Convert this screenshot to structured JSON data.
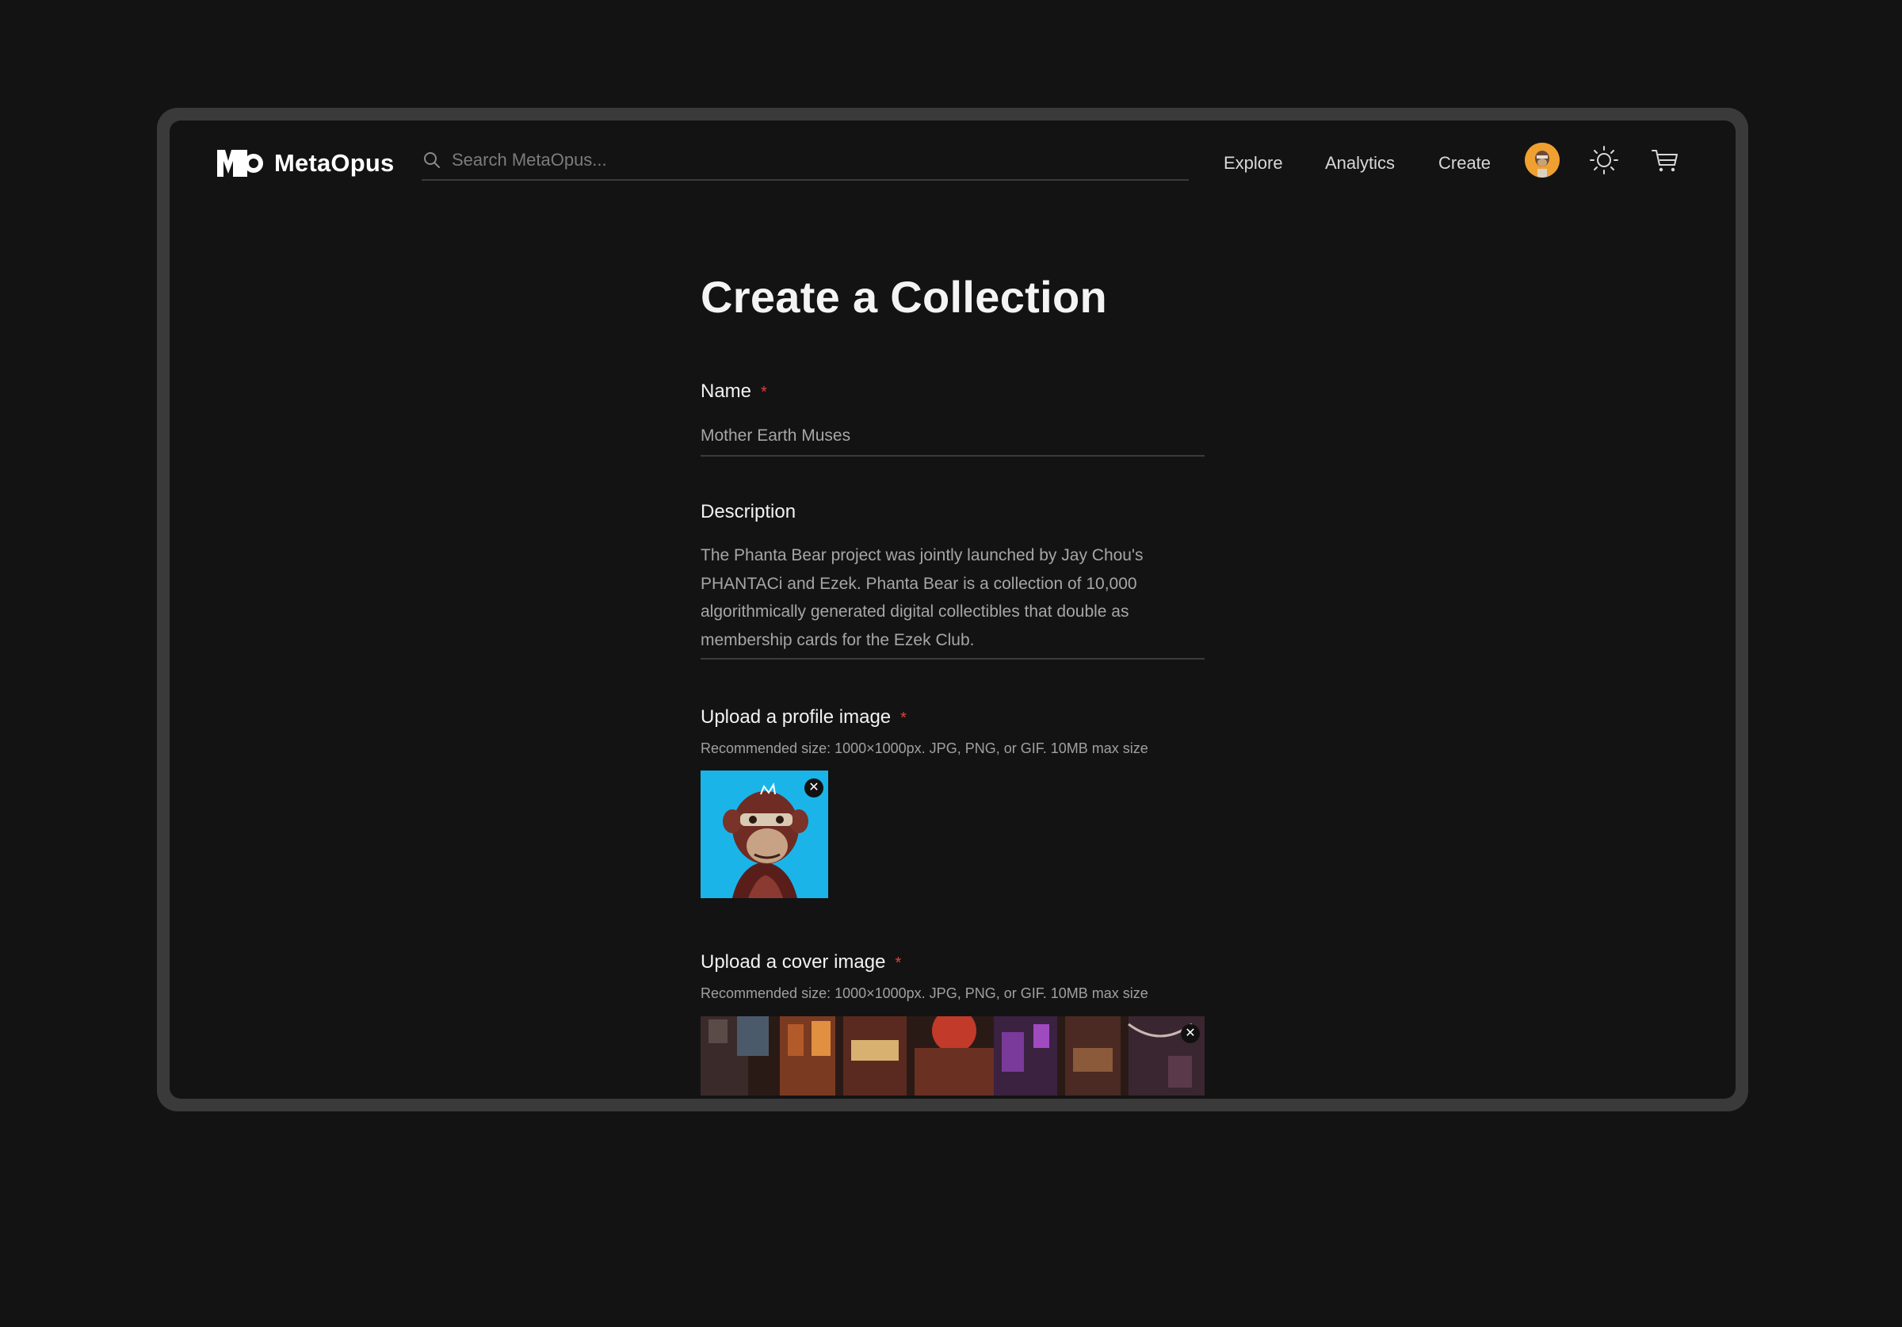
{
  "header": {
    "brand": "MetaOpus",
    "search": {
      "placeholder": "Search MetaOpus...",
      "value": ""
    },
    "nav": [
      {
        "label": "Explore"
      },
      {
        "label": "Analytics"
      },
      {
        "label": "Create"
      }
    ],
    "icons": [
      "user-avatar",
      "sun-icon",
      "cart-icon"
    ]
  },
  "page": {
    "title": "Create a Collection"
  },
  "form": {
    "name": {
      "label": "Name",
      "required_mark": "*",
      "value": "Mother Earth Muses"
    },
    "description": {
      "label": "Description",
      "lines": [
        "The Phanta Bear project was jointly launched by Jay Chou's",
        "PHANTACi and Ezek. Phanta Bear is a collection of 10,000",
        "algorithmically generated digital collectibles that double as",
        "membership cards for the Ezek Club."
      ]
    },
    "profile_image": {
      "label": "Upload a profile image",
      "required_mark": "*",
      "hint": "Recommended size: 1000×1000px. JPG, PNG, or GIF. 10MB max size",
      "remove_symbol": "✕"
    },
    "cover_image": {
      "label": "Upload a cover image",
      "required_mark": "*",
      "hint": "Recommended size: 1000×1000px. JPG, PNG, or GIF. 10MB max size",
      "remove_symbol": "✕"
    }
  },
  "colors": {
    "background": "#131313",
    "frame": "#3a3a3a",
    "required": "#e0433b",
    "avatar": "#f0a030",
    "profile_bg": "#1ab4e8"
  }
}
